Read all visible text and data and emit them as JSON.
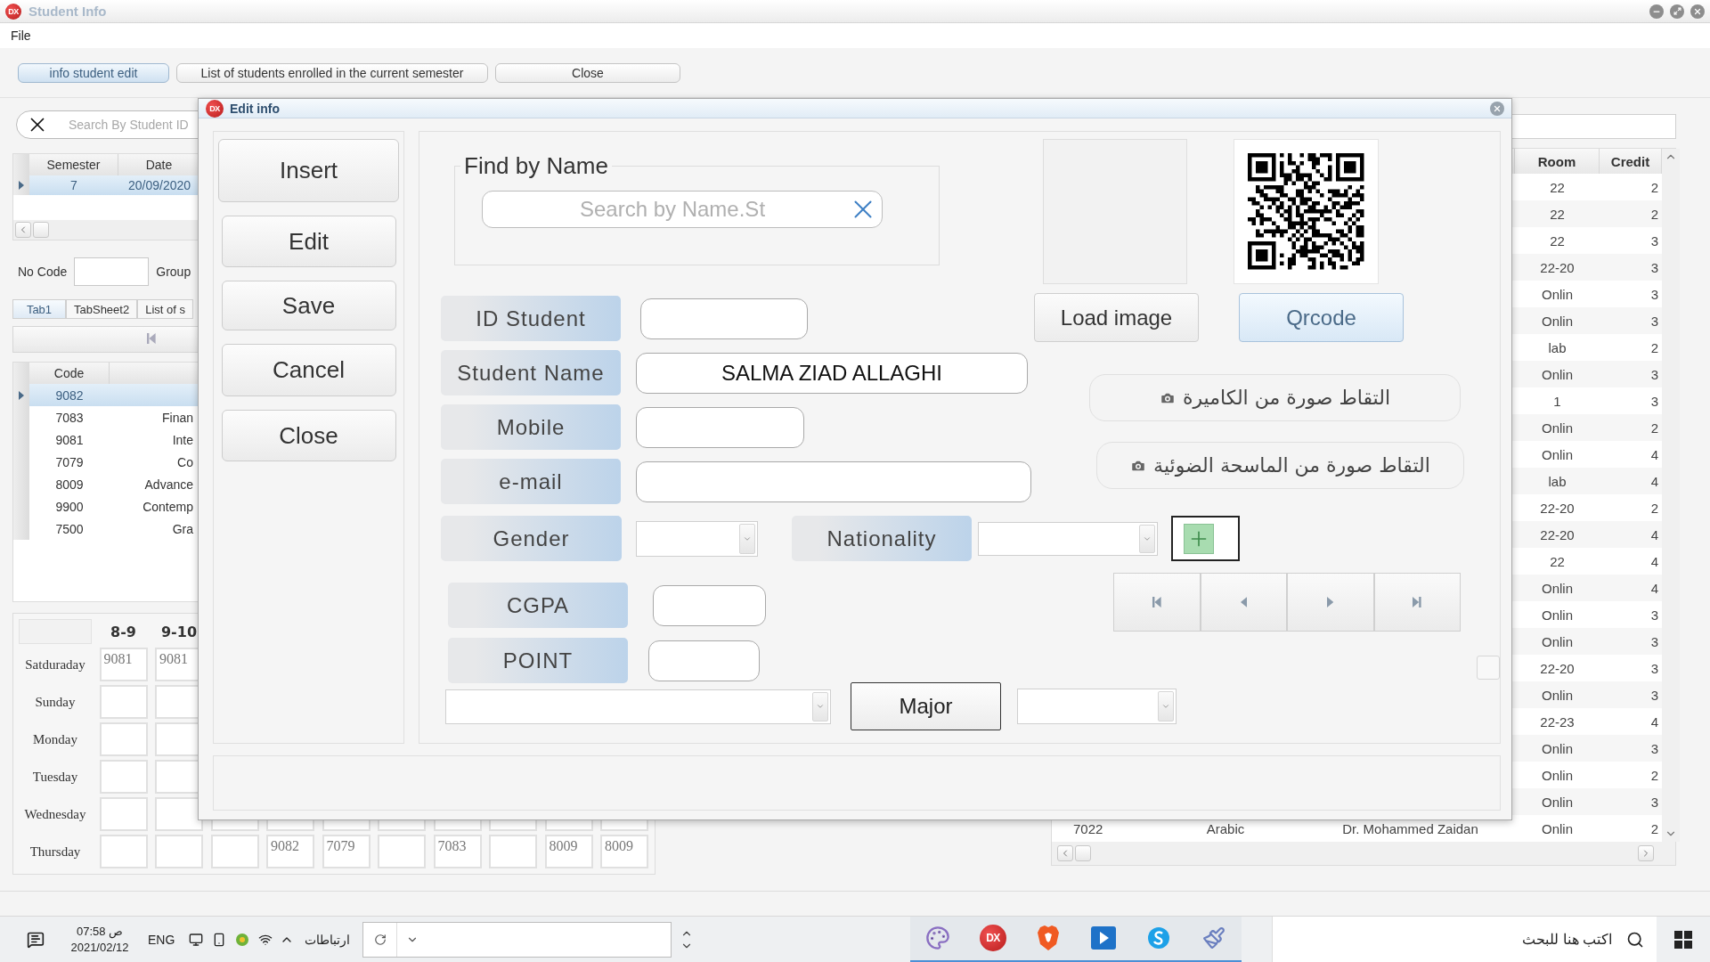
{
  "window": {
    "logo": "DX",
    "title": "Student Info"
  },
  "menu": [
    "File"
  ],
  "toolbar": [
    {
      "label": "info student edit",
      "selected": true
    },
    {
      "label": "List of students enrolled in the current semester",
      "selected": false
    },
    {
      "label": "Close",
      "selected": false
    }
  ],
  "left_panel": {
    "search": {
      "placeholder": "Search By Student ID"
    },
    "semester_grid": {
      "columns": [
        "Semester",
        "Date"
      ],
      "rows": [
        {
          "cells": [
            "7",
            "20/09/2020"
          ],
          "selected": true
        }
      ]
    },
    "no_code_label": "No Code",
    "group_label": "Group",
    "tabs": [
      {
        "label": "Tab1",
        "selected": true
      },
      {
        "label": "TabSheet2",
        "selected": false
      },
      {
        "label": "List of s",
        "selected": false
      }
    ],
    "course_grid": {
      "columns": [
        "Code"
      ],
      "rows": [
        {
          "code": "9082",
          "selected": true
        },
        {
          "code": "7083",
          "column_2": "Finan",
          "selected": false
        },
        {
          "code": "9081",
          "column_2": "Inte",
          "selected": false
        },
        {
          "code": "7079",
          "column_2": "Co",
          "selected": false
        },
        {
          "code": "8009",
          "column_2": "Advance",
          "selected": false
        },
        {
          "code": "9900",
          "column_2": "Contemp",
          "selected": false
        },
        {
          "code": "7500",
          "column_2": "Gra",
          "selected": false
        }
      ]
    }
  },
  "timetable": {
    "slots": [
      "8-9",
      "9-10"
    ],
    "days": [
      {
        "day": "Satduraday",
        "cells": [
          "9081",
          "9081"
        ]
      },
      {
        "day": "Sunday"
      },
      {
        "day": "Monday"
      },
      {
        "day": "Tuesday"
      },
      {
        "day": "Wednesday"
      },
      {
        "day": "Thursday",
        "cells": [
          null,
          null,
          null,
          "9082",
          "7079",
          null,
          "7083",
          null,
          "8009",
          "8009"
        ]
      }
    ]
  },
  "right_table": {
    "columns": [
      "Room",
      "Credit"
    ],
    "rows": [
      {
        "room": "22",
        "credit": "2"
      },
      {
        "room": "22",
        "credit": "2"
      },
      {
        "room": "22",
        "credit": "3"
      },
      {
        "room": "22-20",
        "credit": "3"
      },
      {
        "room": "Onlin",
        "credit": "3"
      },
      {
        "room": "Onlin",
        "credit": "3"
      },
      {
        "room": "lab",
        "credit": "2"
      },
      {
        "room": "Onlin",
        "credit": "3"
      },
      {
        "room": "1",
        "credit": "3"
      },
      {
        "room": "Onlin",
        "credit": "2"
      },
      {
        "room": "Onlin",
        "credit": "4"
      },
      {
        "room": "lab",
        "credit": "4"
      },
      {
        "room": "22-20",
        "credit": "2"
      },
      {
        "room": "22-20",
        "credit": "4"
      },
      {
        "room": "22",
        "credit": "4"
      },
      {
        "room": "Onlin",
        "credit": "4"
      },
      {
        "room": "Onlin",
        "credit": "3"
      },
      {
        "room": "Onlin",
        "credit": "3"
      },
      {
        "room": "22-20",
        "credit": "3"
      },
      {
        "room": "Onlin",
        "credit": "3"
      },
      {
        "room": "22-23",
        "credit": "4"
      },
      {
        "room": "Onlin",
        "credit": "3"
      },
      {
        "room": "Onlin",
        "credit": "2"
      },
      {
        "room": "Onlin",
        "credit": "3"
      },
      {
        "code": "7022",
        "course": "Arabic",
        "instructor": "Dr. Mohammed Zaidan",
        "room": "Onlin",
        "credit": "2"
      }
    ]
  },
  "dialog": {
    "logo": "DX",
    "title": "Edit info",
    "actions": [
      "Insert",
      "Edit",
      "Save",
      "Cancel",
      "Close"
    ],
    "find": {
      "title": "Find by Name",
      "placeholder": "Search by Name.St"
    },
    "fields": [
      {
        "label": "ID Student"
      },
      {
        "label": "Student Name",
        "value": "SALMA ZIAD ALLAGHI"
      },
      {
        "label": "Mobile"
      },
      {
        "label": "e-mail"
      }
    ],
    "gender": {
      "label": "Gender"
    },
    "nationality": {
      "label": "Nationality"
    },
    "cgpa": {
      "label": "CGPA"
    },
    "point": {
      "label": "POINT"
    },
    "major": {
      "label": "Major"
    },
    "image_buttons": [
      {
        "label": "Load image",
        "selected": false
      },
      {
        "label": "Qrcode",
        "selected": true
      }
    ],
    "capture_buttons": [
      "التقاط صورة من الكاميرة",
      "التقاط صورة من الماسحة الضوئية"
    ]
  },
  "taskbar": {
    "time": "07:58 ص",
    "date": "2021/02/12",
    "language": "ENG",
    "tray_label": "ارتباطات",
    "app_logo": "DX",
    "search_placeholder": "اكتب هنا للبحث"
  }
}
